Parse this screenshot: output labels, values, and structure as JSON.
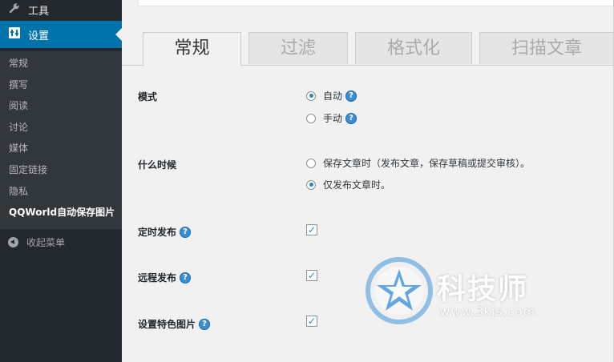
{
  "sidebar": {
    "tools_label": "工具",
    "settings_label": "设置",
    "submenu": [
      "常规",
      "撰写",
      "阅读",
      "讨论",
      "媒体",
      "固定链接",
      "隐私",
      "QQWorld自动保存图片"
    ],
    "collapse_label": "收起菜单",
    "icons": {
      "tools": "wrench-icon",
      "settings": "settings-sliders-icon",
      "collapse": "collapse-arrow-icon"
    }
  },
  "tabs": [
    "常规",
    "过滤",
    "格式化",
    "扫描文章"
  ],
  "active_tab": "常规",
  "form": {
    "mode": {
      "label": "模式",
      "options": [
        "自动",
        "手动"
      ],
      "selected": "自动"
    },
    "when": {
      "label": "什么时候",
      "options": [
        "保存文章时（发布文章，保存草稿或提交审核）。",
        "仅发布文章时。"
      ],
      "selected": "仅发布文章时。"
    },
    "scheduled": {
      "label": "定时发布",
      "checked": true
    },
    "remote": {
      "label": "远程发布",
      "checked": true
    },
    "featured": {
      "label": "设置特色图片",
      "checked": true
    },
    "help_glyph": "?"
  },
  "watermark": {
    "brand": "科技师",
    "url": "www.3kjs.com"
  },
  "colors": {
    "sidebar_bg": "#23282d",
    "submenu_bg": "#32373c",
    "accent": "#0073aa",
    "help_blue": "#3b8dd1",
    "check": "#1e8cbe"
  }
}
